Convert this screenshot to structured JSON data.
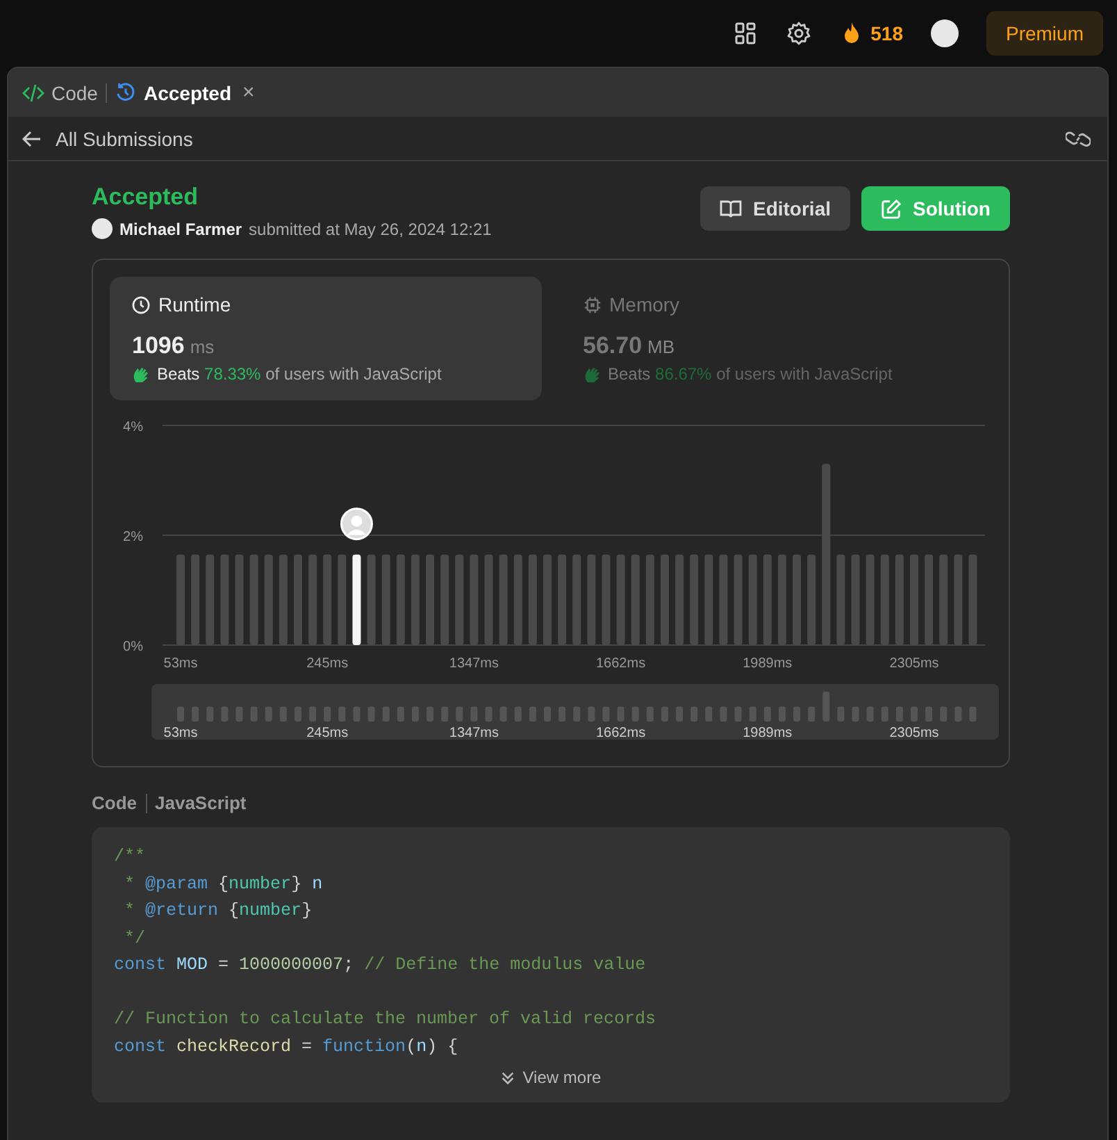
{
  "top_bar": {
    "streak": "518",
    "premium": "Premium"
  },
  "tabs": [
    {
      "label": "Code",
      "kind": "code",
      "selected": false
    },
    {
      "label": "Accepted",
      "kind": "history",
      "selected": true,
      "close": "×"
    }
  ],
  "sub_header": {
    "back": "All Submissions"
  },
  "submission": {
    "status": "Accepted",
    "user": "Michael Farmer",
    "submitted_text": "submitted at May 26, 2024 12:21",
    "editorial": "Editorial",
    "solution": "Solution"
  },
  "metrics": [
    {
      "title": "Runtime",
      "kind": "clock",
      "value": "1096",
      "unit": "ms",
      "beats_label": "Beats",
      "beats_value": "78.33%",
      "beats_suffix": "of users with JavaScript",
      "selected": true
    },
    {
      "title": "Memory",
      "kind": "chip",
      "value": "56.70",
      "unit": "MB",
      "beats_label": "Beats",
      "beats_value": "86.67%",
      "beats_suffix": "of users with JavaScript",
      "selected": false
    }
  ],
  "chart_data": {
    "type": "bar",
    "stacked": true,
    "ylim": [
      0,
      4
    ],
    "yticks": [
      {
        "value": 0,
        "label": "0%"
      },
      {
        "value": 2,
        "label": "2%"
      },
      {
        "value": 4,
        "label": "4%"
      }
    ],
    "categories": [
      "53ms",
      null,
      null,
      null,
      null,
      null,
      null,
      null,
      null,
      null,
      "245ms",
      null,
      null,
      null,
      null,
      null,
      null,
      null,
      null,
      null,
      "1347ms",
      null,
      null,
      null,
      null,
      null,
      null,
      null,
      null,
      null,
      "1662ms",
      null,
      null,
      null,
      null,
      null,
      null,
      null,
      null,
      null,
      "1989ms",
      null,
      null,
      null,
      null,
      null,
      null,
      null,
      null,
      null,
      "2305ms",
      null,
      null,
      null,
      null
    ],
    "series": [
      {
        "color": "#4a4a4a",
        "values": [
          1.65,
          1.65,
          1.65,
          1.65,
          1.65,
          1.65,
          1.65,
          1.65,
          1.65,
          1.65,
          1.65,
          1.65,
          null,
          1.65,
          1.65,
          1.65,
          1.65,
          1.65,
          1.65,
          1.65,
          1.65,
          1.65,
          1.65,
          1.65,
          1.65,
          1.65,
          1.65,
          1.65,
          1.65,
          1.65,
          1.65,
          1.65,
          1.65,
          1.65,
          1.65,
          1.65,
          1.65,
          1.65,
          1.65,
          1.65,
          1.65,
          1.65,
          1.65,
          1.65,
          3.3,
          1.65,
          1.65,
          1.65,
          1.65,
          1.65,
          1.65,
          1.65,
          1.65,
          1.65,
          1.65
        ]
      },
      {
        "color": "#f5f5f5",
        "values": [
          null,
          null,
          null,
          null,
          null,
          null,
          null,
          null,
          null,
          null,
          null,
          null,
          1.65,
          null,
          null,
          null,
          null,
          null,
          null,
          null,
          null,
          null,
          null,
          null,
          null,
          null,
          null,
          null,
          null,
          null,
          null,
          null,
          null,
          null,
          null,
          null,
          null,
          null,
          null,
          null,
          null,
          null,
          null,
          null,
          null,
          null,
          null,
          null,
          null,
          null,
          null,
          null,
          null,
          null,
          null
        ]
      }
    ]
  },
  "navigator": {
    "labels": [
      "53ms",
      "245ms",
      "1347ms",
      "1662ms",
      "1989ms",
      "2305ms"
    ]
  },
  "code": {
    "title": "Code",
    "language": "JavaScript",
    "view_more": "View more",
    "lines": [
      {
        "kind": "code",
        "tokens": [
          {
            "t": "/**",
            "color": "#6a9955"
          }
        ]
      },
      {
        "kind": "code",
        "tokens": [
          {
            "t": " * ",
            "color": "#6a9955"
          },
          {
            "t": "@param",
            "color": "#569cd6"
          },
          {
            "t": " {",
            "color": "#d4d4d4"
          },
          {
            "t": "number",
            "color": "#4ec9b0"
          },
          {
            "t": "}",
            "color": "#d4d4d4"
          },
          {
            "t": " n",
            "color": "#9cdcfe"
          }
        ]
      },
      {
        "kind": "code",
        "tokens": [
          {
            "t": " * ",
            "color": "#6a9955"
          },
          {
            "t": "@return",
            "color": "#569cd6"
          },
          {
            "t": " {",
            "color": "#d4d4d4"
          },
          {
            "t": "number",
            "color": "#4ec9b0"
          },
          {
            "t": "}",
            "color": "#d4d4d4"
          }
        ]
      },
      {
        "kind": "code",
        "tokens": [
          {
            "t": " */",
            "color": "#6a9955"
          }
        ]
      },
      {
        "kind": "code",
        "tokens": [
          {
            "t": "const",
            "color": "#569cd6"
          },
          {
            "t": " MOD",
            "color": "#9cdcfe"
          },
          {
            "t": " = ",
            "color": "#d4d4d4"
          },
          {
            "t": "1000000007",
            "color": "#b5cea8"
          },
          {
            "t": "; ",
            "color": "#d4d4d4"
          },
          {
            "t": "// Define the modulus value",
            "color": "#6a9955"
          }
        ]
      },
      {
        "kind": "blank"
      },
      {
        "kind": "code",
        "tokens": [
          {
            "t": "// Function to calculate the number of valid records",
            "color": "#6a9955"
          }
        ]
      },
      {
        "kind": "code",
        "tokens": [
          {
            "t": "const",
            "color": "#569cd6"
          },
          {
            "t": " checkRecord",
            "color": "#dcdcaa"
          },
          {
            "t": " = ",
            "color": "#d4d4d4"
          },
          {
            "t": "function",
            "color": "#569cd6"
          },
          {
            "t": "(",
            "color": "#d4d4d4"
          },
          {
            "t": "n",
            "color": "#9cdcfe"
          },
          {
            "t": ") {",
            "color": "#d4d4d4"
          }
        ]
      }
    ]
  }
}
